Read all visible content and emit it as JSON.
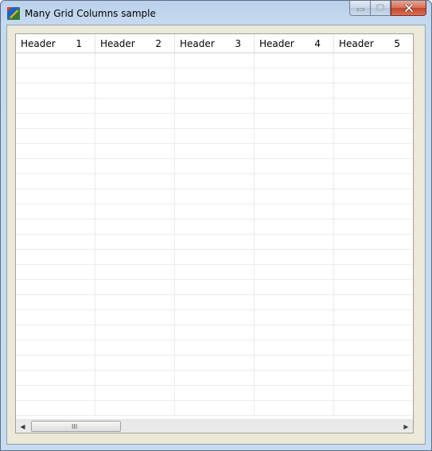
{
  "window": {
    "title": "Many Grid Columns sample",
    "icons": {
      "app": "app-icon",
      "minimize": "minimize-icon",
      "maximize": "maximize-icon",
      "close": "close-icon"
    }
  },
  "grid": {
    "columns": [
      {
        "label": "Header",
        "number": "1"
      },
      {
        "label": "Header",
        "number": "2"
      },
      {
        "label": "Header",
        "number": "3"
      },
      {
        "label": "Header",
        "number": "4"
      },
      {
        "label": "Header",
        "number": "5"
      }
    ],
    "visible_rows": 24
  },
  "scrollbar": {
    "left_arrow": "◀",
    "right_arrow": "▶",
    "grip": "III",
    "position": 0.0
  }
}
